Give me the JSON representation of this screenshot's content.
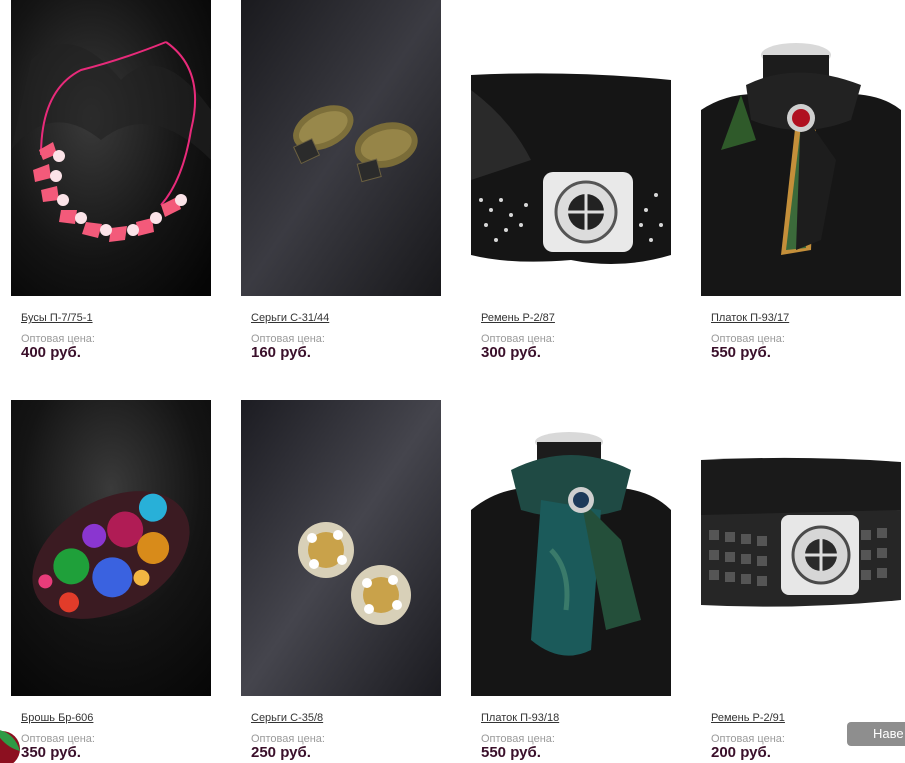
{
  "products": [
    {
      "name": "Бусы П-7/75-1",
      "price_label": "Оптовая цена:",
      "price": "400 руб.",
      "photo": "pink-butterfly-necklace"
    },
    {
      "name": "Серьги С-31/44",
      "price_label": "Оптовая цена:",
      "price": "160 руб.",
      "photo": "bronze-clip-earrings"
    },
    {
      "name": "Ремень Р-2/87",
      "price_label": "Оптовая цена:",
      "price": "300 руб.",
      "photo": "black-rhinestone-belt"
    },
    {
      "name": "Платок П-93/17",
      "price_label": "Оптовая цена:",
      "price": "550 руб.",
      "photo": "peacock-scarf-on-mannequin"
    },
    {
      "name": "Брошь Бр-606",
      "price_label": "Оптовая цена:",
      "price": "350 руб.",
      "photo": "multicolor-crystal-brooch"
    },
    {
      "name": "Серьги С-35/8",
      "price_label": "Оптовая цена:",
      "price": "250 руб.",
      "photo": "crystal-flower-earrings"
    },
    {
      "name": "Платок П-93/18",
      "price_label": "Оптовая цена:",
      "price": "550 руб.",
      "photo": "teal-scarf-on-mannequin"
    },
    {
      "name": "Ремень Р-2/91",
      "price_label": "Оптовая цена:",
      "price": "200 руб.",
      "photo": "studded-black-belt"
    }
  ],
  "scroll_top_button": {
    "label": "Наве"
  },
  "colors": {
    "price": "#3a0f2a",
    "label": "#9a9a9a",
    "button": "#8e8e8e"
  }
}
